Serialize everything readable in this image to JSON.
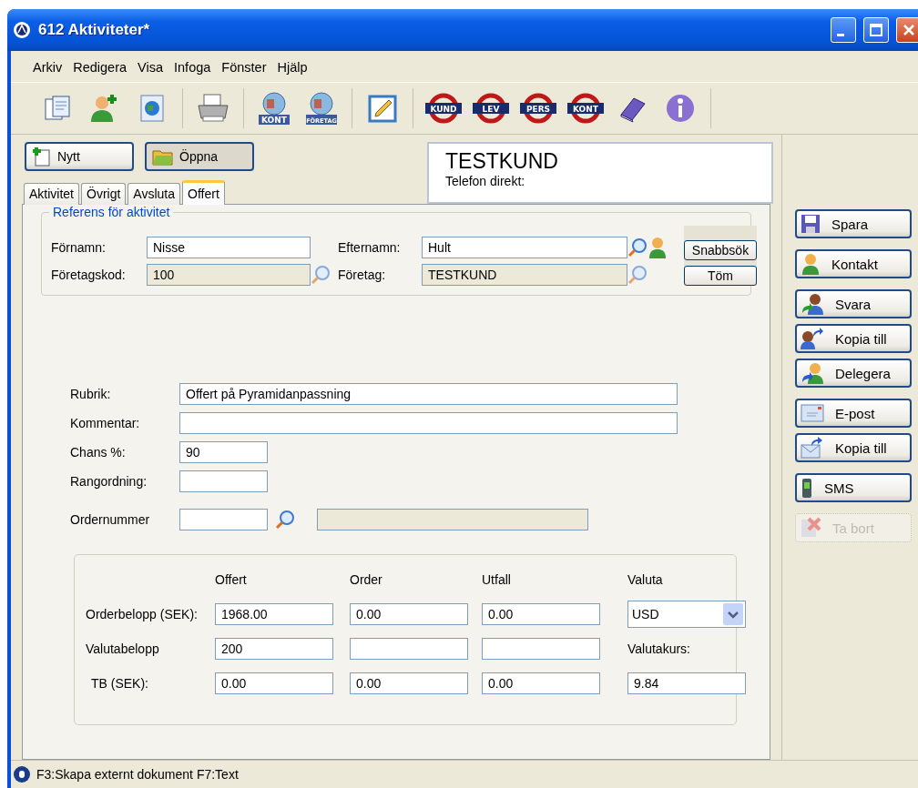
{
  "window": {
    "title": "612 Aktiviteter*"
  },
  "menu": [
    "Arkiv",
    "Redigera",
    "Visa",
    "Infoga",
    "Fönster",
    "Hjälp"
  ],
  "toolbar": [
    [
      {
        "kind": "document"
      },
      {
        "kind": "person-add"
      },
      {
        "kind": "web-page"
      }
    ],
    [
      {
        "kind": "printer"
      }
    ],
    [
      {
        "kind": "globe-label",
        "label": "KONT"
      },
      {
        "kind": "globe-label",
        "label": "FÖRETAG"
      }
    ],
    [
      {
        "kind": "notepad"
      }
    ],
    [
      {
        "kind": "sign",
        "label": "KUND"
      },
      {
        "kind": "sign",
        "label": "LEV"
      },
      {
        "kind": "sign",
        "label": "PERS"
      },
      {
        "kind": "sign",
        "label": "KONT"
      },
      {
        "kind": "book"
      },
      {
        "kind": "help"
      }
    ]
  ],
  "actions": [
    {
      "label": "Nytt",
      "kind": "new",
      "pressed": false
    },
    {
      "label": "Öppna",
      "kind": "folder",
      "pressed": true
    }
  ],
  "customer": {
    "name": "TESTKUND",
    "phone_label": "Telefon direkt:"
  },
  "tabs": [
    {
      "label": "Aktivitet",
      "selected": false
    },
    {
      "label": "Övrigt",
      "selected": false
    },
    {
      "label": "Avsluta",
      "selected": false
    },
    {
      "label": "Offert",
      "selected": true
    }
  ],
  "reference": {
    "legend": "Referens för aktivitet",
    "fields": [
      {
        "label": "Förnamn:",
        "value": "Nisse",
        "readonly": false
      },
      {
        "label": "Efternamn:",
        "value": "Hult",
        "readonly": false
      },
      {
        "label": "Företagskod:",
        "value": "100",
        "readonly": true
      },
      {
        "label": "Företag:",
        "value": "TESTKUND",
        "readonly": true
      }
    ],
    "buttons": [
      "Snabbsök",
      "Töm"
    ]
  },
  "form": {
    "rubrik": {
      "label": "Rubrik:",
      "value": "Offert på Pyramidanpassning"
    },
    "kommentar": {
      "label": "Kommentar:"
    },
    "chans": {
      "label": "Chans %:",
      "value": "90"
    },
    "rangordning": {
      "label": "Rangordning:"
    },
    "ordernummer": {
      "label": "Ordernummer"
    }
  },
  "amounts": {
    "columns": [
      "Offert",
      "Order",
      "Utfall",
      "Valuta"
    ],
    "rows": [
      {
        "label": "Orderbelopp (SEK):",
        "values": [
          "1968.00",
          "0.00",
          "0.00"
        ]
      },
      {
        "label": "Valutabelopp",
        "values": [
          "200"
        ]
      },
      {
        "label": "TB (SEK):",
        "values": [
          "0.00",
          "0.00",
          "0.00"
        ]
      }
    ],
    "currency": "USD",
    "rate_label": "Valutakurs:",
    "rate": "9.84"
  },
  "side_buttons": [
    [
      {
        "label": "Spara",
        "kind": "save",
        "disabled": false
      }
    ],
    [
      {
        "label": "Kontakt",
        "kind": "contact",
        "disabled": false
      }
    ],
    [
      {
        "label": "Svara",
        "kind": "reply",
        "disabled": false
      },
      {
        "label": "Kopia till",
        "kind": "copy",
        "disabled": false
      },
      {
        "label": "Delegera",
        "kind": "delegate",
        "disabled": false
      }
    ],
    [
      {
        "label": "E-post",
        "kind": "email",
        "disabled": false
      },
      {
        "label": "Kopia till",
        "kind": "mail-copy",
        "disabled": false
      }
    ],
    [
      {
        "label": "SMS",
        "kind": "phone",
        "disabled": false
      }
    ],
    [
      {
        "label": "Ta bort",
        "kind": "delete",
        "disabled": true
      }
    ]
  ],
  "status_bar": "F3:Skapa externt dokument  F7:Text"
}
